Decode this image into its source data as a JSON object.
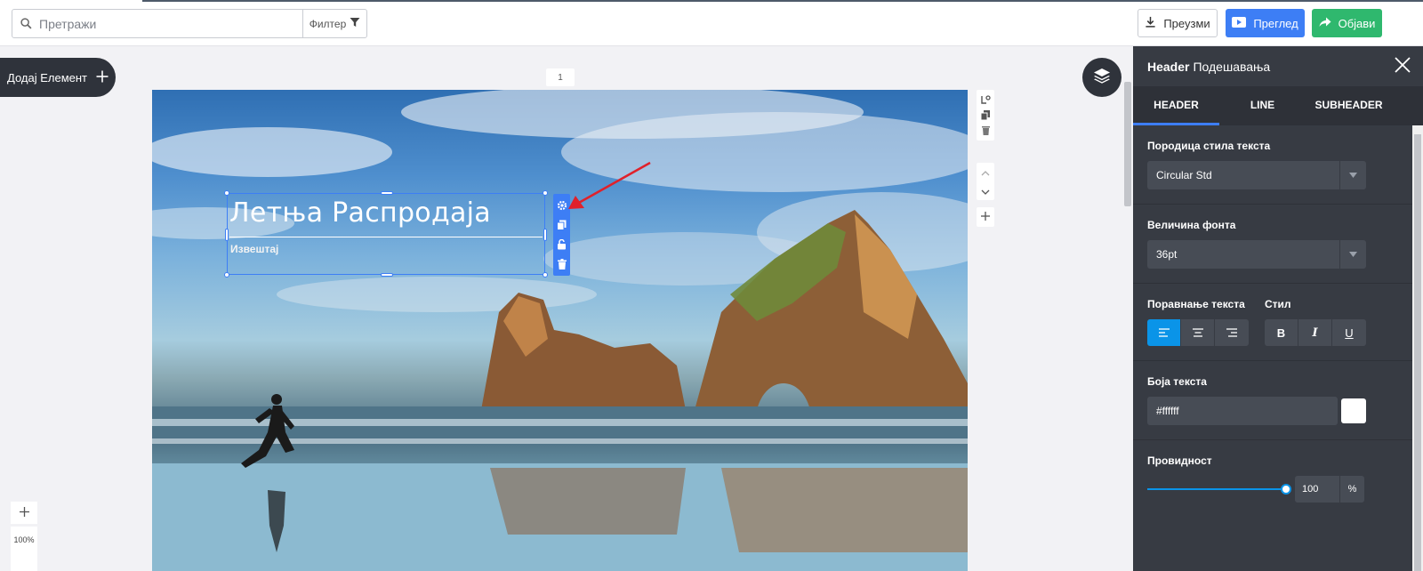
{
  "search": {
    "placeholder": "Претражи",
    "filter_label": "Филтер"
  },
  "header_actions": {
    "download_label": "Преузми",
    "preview_label": "Преглед",
    "publish_label": "Објави"
  },
  "add_element_label": "Додај Елемент",
  "page_number": "1",
  "canvas": {
    "heading_text": "Летња Распродаја",
    "subheading_text": "Извештај"
  },
  "zoom": {
    "value": "100%"
  },
  "panel": {
    "title_bold": "Header",
    "title_rest": "Подешавања",
    "tabs": [
      {
        "label": "HEADER",
        "active": true
      },
      {
        "label": "LINE",
        "active": false
      },
      {
        "label": "SUBHEADER",
        "active": false
      }
    ],
    "font_family": {
      "label": "Породица стила текста",
      "value": "Circular Std"
    },
    "font_size": {
      "label": "Величина фонта",
      "value": "36pt"
    },
    "alignment_label": "Поравнање текста",
    "style_label": "Стил",
    "style_buttons": {
      "bold": "B",
      "italic": "I",
      "underline": "U"
    },
    "text_color": {
      "label": "Боја текста",
      "value": "#ffffff"
    },
    "opacity": {
      "label": "Провидност",
      "value": "100",
      "unit": "%",
      "fraction": 1.0
    }
  },
  "colors": {
    "primary": "#3d7ef5",
    "publish": "#2fb86e",
    "panel_bg": "#373b43",
    "active_toggle": "#0a94e8"
  }
}
